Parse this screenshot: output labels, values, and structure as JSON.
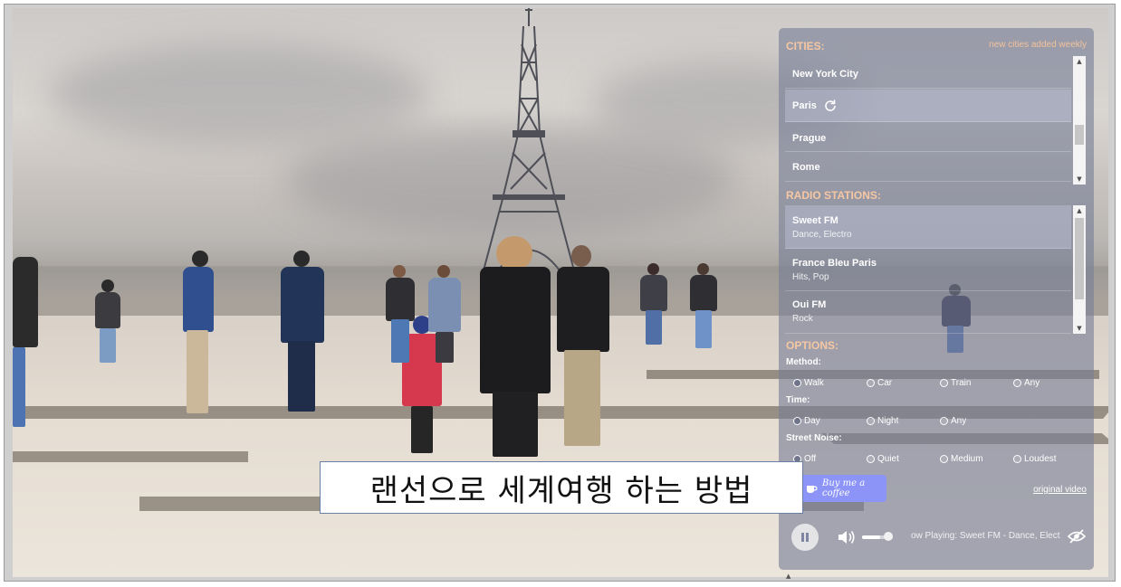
{
  "panel": {
    "cities": {
      "title": "CITIES:",
      "note": "new cities added weekly",
      "items": [
        "New York City",
        "Paris",
        "Prague",
        "Rome"
      ],
      "selected": "Paris"
    },
    "radio": {
      "title": "RADIO STATIONS:",
      "stations": [
        {
          "name": "Sweet FM",
          "genre": "Dance, Electro"
        },
        {
          "name": "France Bleu Paris",
          "genre": "Hits, Pop"
        },
        {
          "name": "Oui FM",
          "genre": "Rock"
        }
      ]
    },
    "options": {
      "title": "OPTIONS:",
      "method": {
        "label": "Method:",
        "choices": [
          "Walk",
          "Car",
          "Train",
          "Any"
        ],
        "selected": "Walk"
      },
      "time": {
        "label": "Time:",
        "choices": [
          "Day",
          "Night",
          "Any"
        ],
        "selected": "Day"
      },
      "noise": {
        "label": "Street Noise:",
        "choices": [
          "Off",
          "Quiet",
          "Medium",
          "Loudest"
        ],
        "selected": "Off"
      }
    },
    "coffee_label": "Buy me a coffee",
    "original_video_label": "original video",
    "player": {
      "now_playing": "ow Playing: Sweet FM - Dance, Elect",
      "volume": 0.6
    }
  },
  "caption": "랜선으로 세계여행 하는 방법",
  "colors": {
    "panel": "#787e96",
    "section_title": "#f6c7a3",
    "coffee": "#8c95f7"
  }
}
